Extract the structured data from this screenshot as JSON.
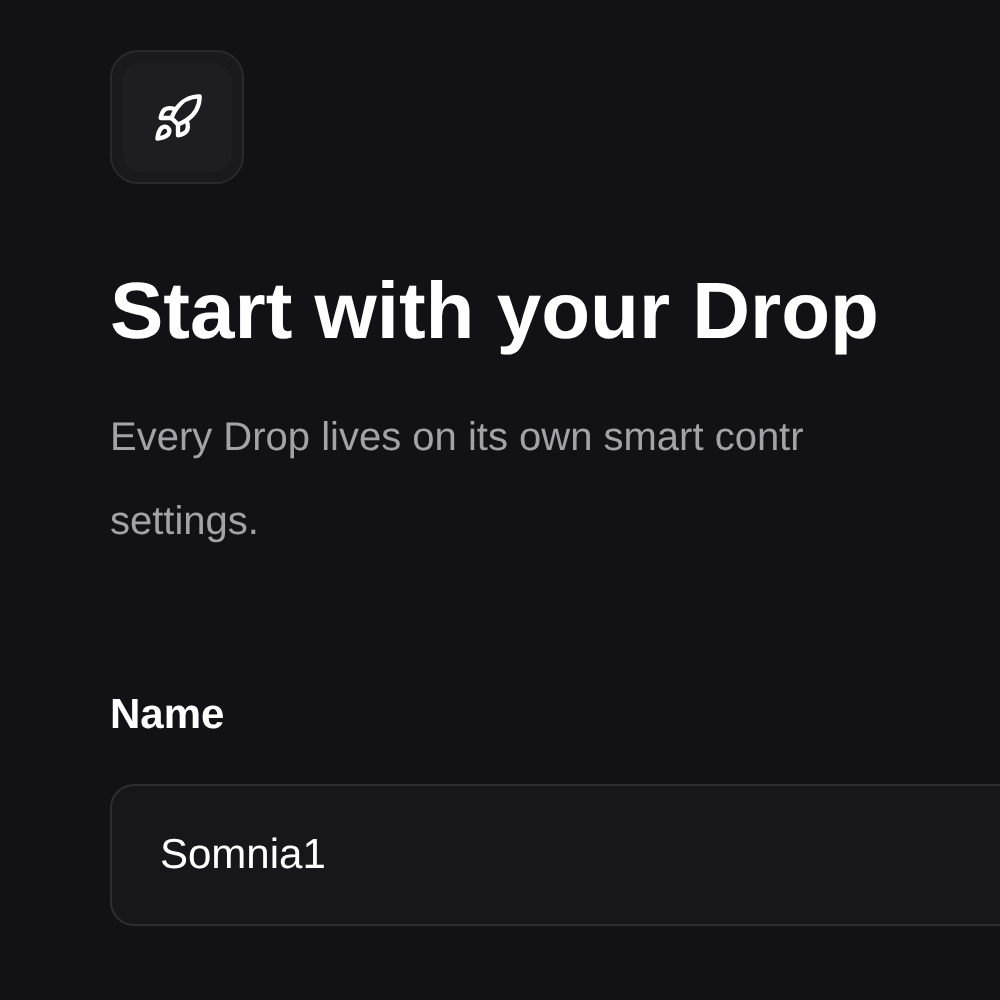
{
  "heading": "Start with your Drop",
  "description_lines": [
    "Every Drop lives on its own smart contr",
    "settings."
  ],
  "name_field": {
    "label": "Name",
    "value": "Somnia1"
  }
}
